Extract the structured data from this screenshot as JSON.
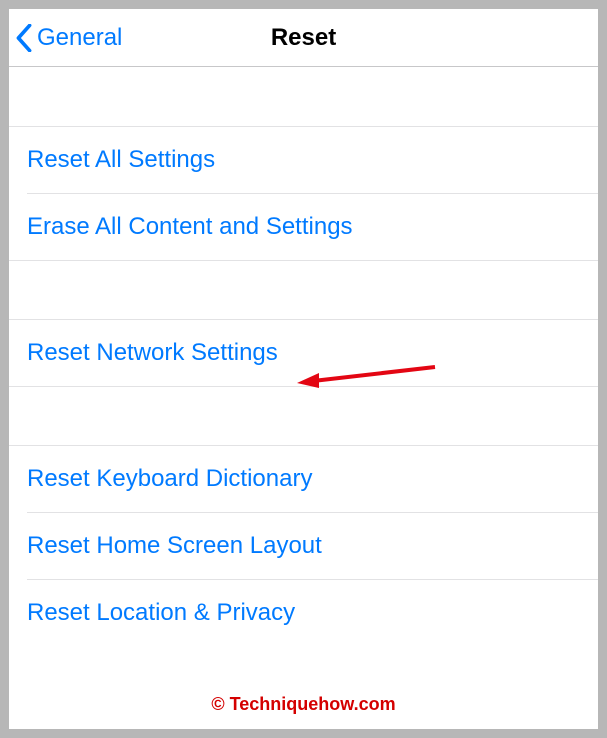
{
  "nav": {
    "back_label": "General",
    "title": "Reset"
  },
  "rows": {
    "reset_all": "Reset All Settings",
    "erase_all": "Erase All Content and Settings",
    "reset_network": "Reset Network Settings",
    "reset_keyboard": "Reset Keyboard Dictionary",
    "reset_home": "Reset Home Screen Layout",
    "reset_location": "Reset Location & Privacy"
  },
  "watermark": "© Techniquehow.com",
  "colors": {
    "link": "#007aff",
    "annotation": "#e30613"
  }
}
